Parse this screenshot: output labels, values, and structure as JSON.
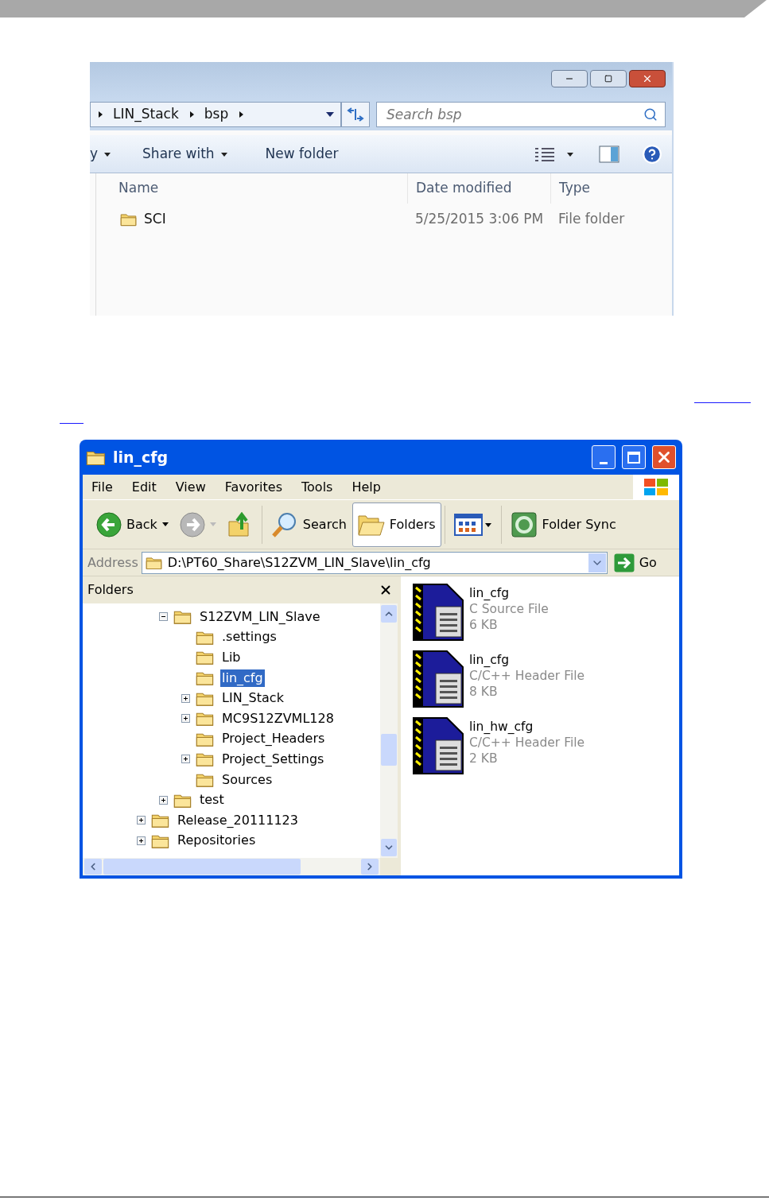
{
  "explorer7": {
    "breadcrumb": [
      "LIN_Stack",
      "bsp"
    ],
    "search": {
      "placeholder": "Search bsp"
    },
    "toolbar": [
      {
        "label": "y",
        "dropdown": true
      },
      {
        "label": "Share with",
        "dropdown": true
      },
      {
        "label": "New folder",
        "dropdown": false
      }
    ],
    "columns": [
      "Name",
      "Date modified",
      "Type"
    ],
    "rows": [
      {
        "name": "SCI",
        "date": "5/25/2015 3:06 PM",
        "type": "File folder"
      }
    ]
  },
  "explorer_xp": {
    "title": "lin_cfg",
    "menu": [
      "File",
      "Edit",
      "View",
      "Favorites",
      "Tools",
      "Help"
    ],
    "toolbar": [
      {
        "kind": "back",
        "label": "Back",
        "selected": false
      },
      {
        "kind": "forward",
        "selected": false
      },
      {
        "kind": "up",
        "selected": false
      },
      {
        "kind": "search",
        "label": "Search",
        "selected": false
      },
      {
        "kind": "folders",
        "label": "Folders",
        "selected": true
      },
      {
        "kind": "views",
        "selected": false
      },
      {
        "kind": "sync",
        "label": "Folder Sync",
        "selected": false
      }
    ],
    "address": {
      "label": "Address",
      "value": "D:\\PT60_Share\\S12ZVM_LIN_Slave\\lin_cfg",
      "go": "Go"
    },
    "folders_pane": {
      "title": "Folders",
      "nested_items": [
        {
          "label": "S12ZVM_LIN_Slave",
          "kind": "expanded",
          "selected": false,
          "children": [
            {
              "label": ".settings",
              "kind": "leaf",
              "selected": false
            },
            {
              "label": "Lib",
              "kind": "leaf",
              "selected": false
            },
            {
              "label": "lin_cfg",
              "kind": "leaf",
              "selected": true
            },
            {
              "label": "LIN_Stack",
              "kind": "collapsed",
              "selected": false
            },
            {
              "label": "MC9S12ZVML128",
              "kind": "collapsed",
              "selected": false
            },
            {
              "label": "Project_Headers",
              "kind": "leaf",
              "selected": false
            },
            {
              "label": "Project_Settings",
              "kind": "collapsed",
              "selected": false
            },
            {
              "label": "Sources",
              "kind": "leaf",
              "selected": false
            }
          ]
        },
        {
          "label": "test",
          "kind": "collapsed",
          "selected": false
        }
      ],
      "items": [
        {
          "label": "Release_20111123",
          "kind": "collapsed",
          "selected": false
        },
        {
          "label": "Repositories",
          "kind": "collapsed",
          "selected": false
        }
      ]
    },
    "files": [
      {
        "name": "lin_cfg",
        "type": "C Source File",
        "size": "6 KB"
      },
      {
        "name": "lin_cfg",
        "type": "C/C++ Header File",
        "size": "8 KB"
      },
      {
        "name": "lin_hw_cfg",
        "type": "C/C++ Header File",
        "size": "2 KB"
      }
    ]
  }
}
